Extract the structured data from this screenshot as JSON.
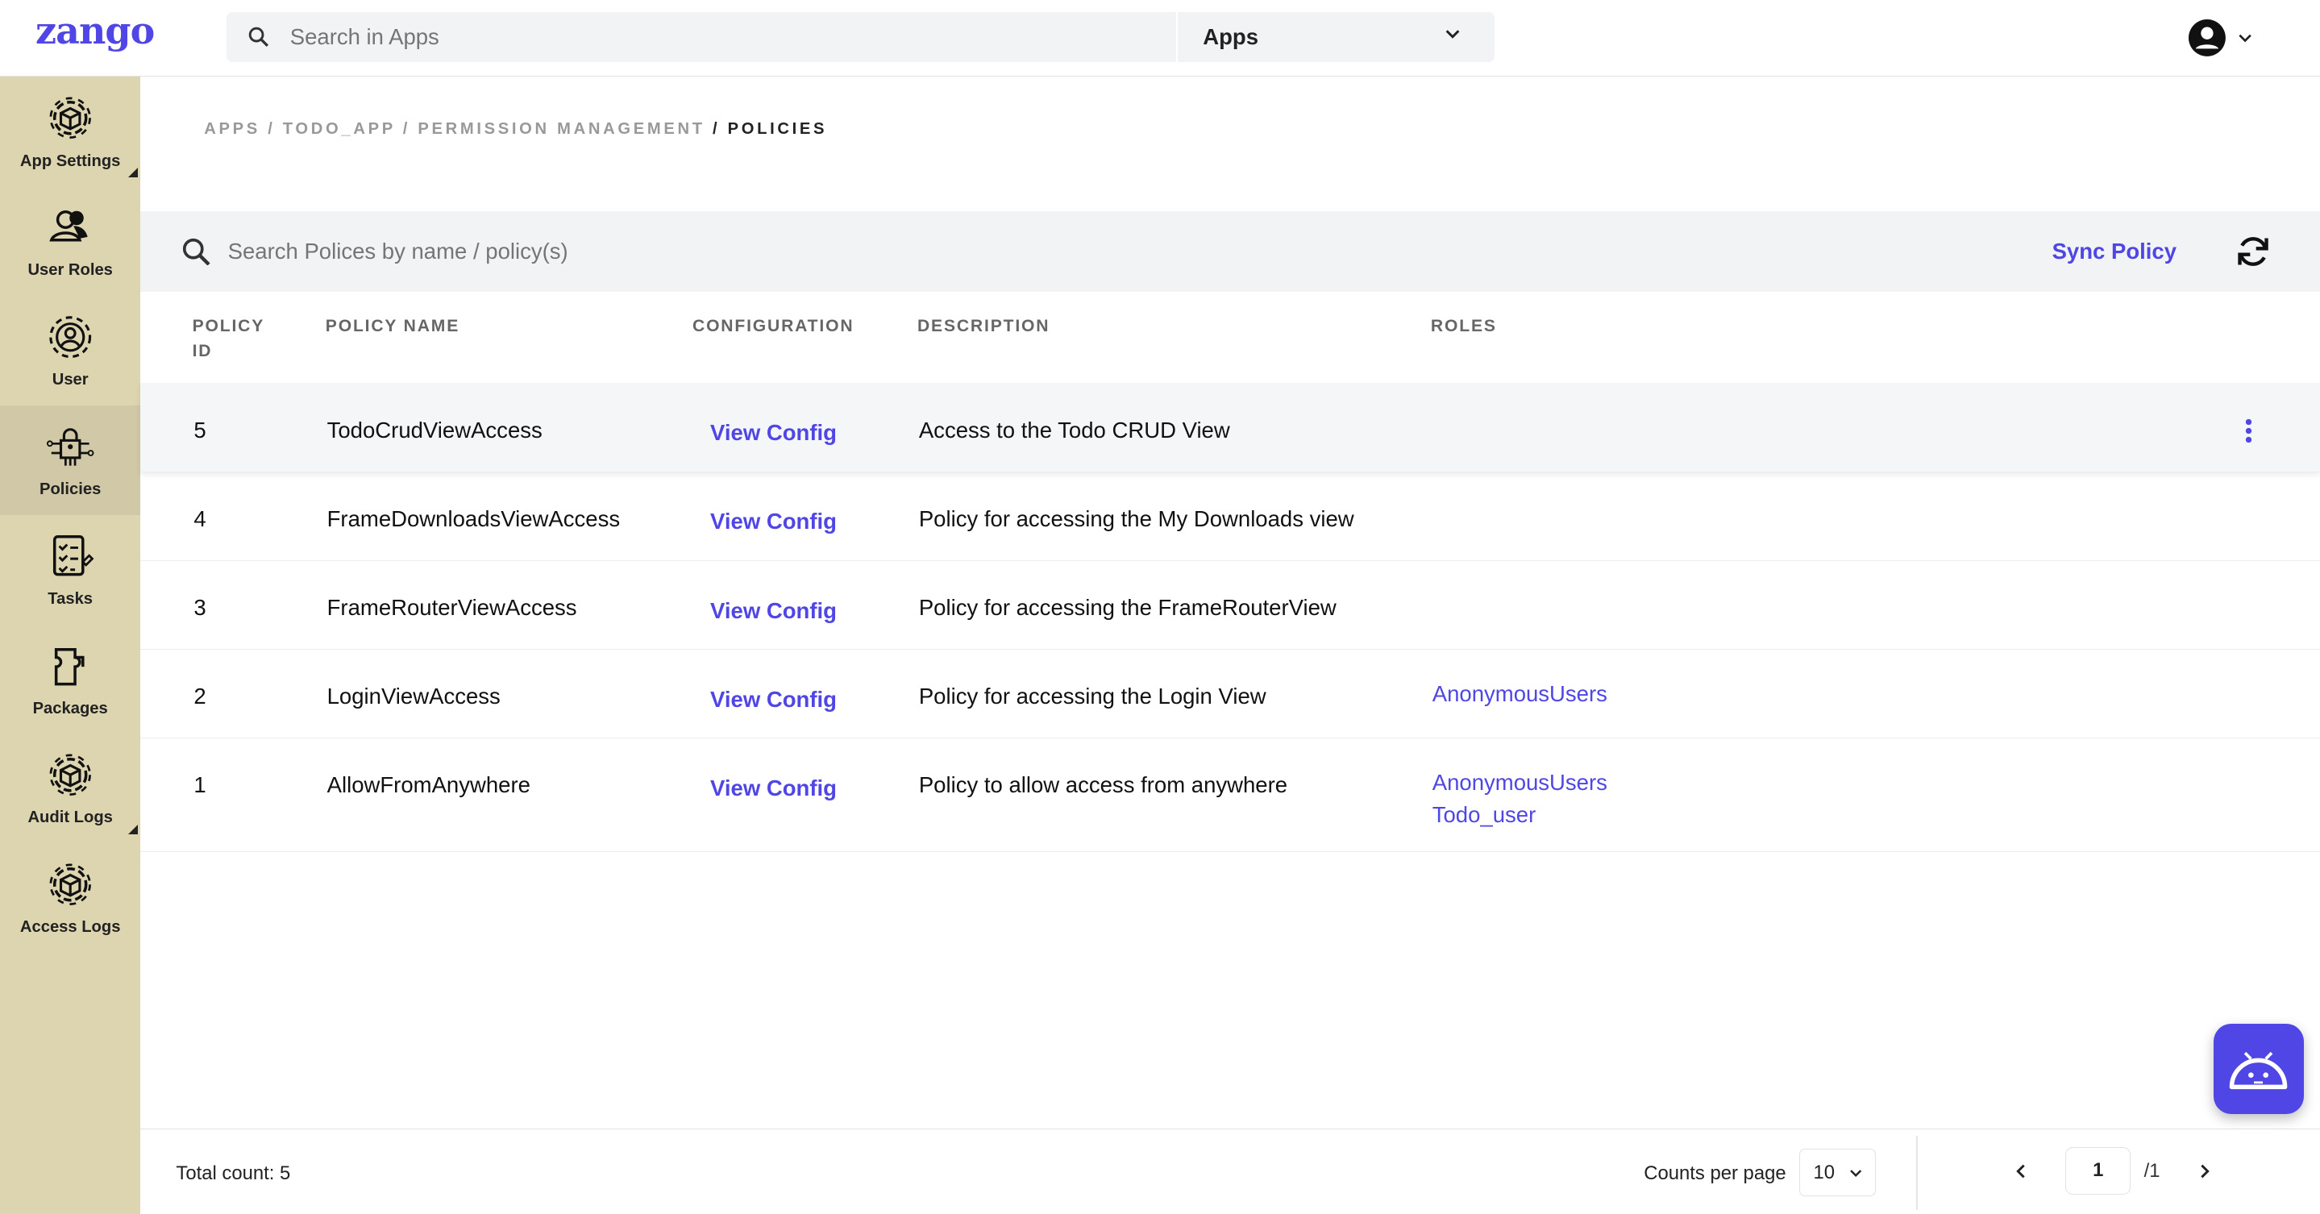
{
  "header": {
    "logo": "zango",
    "search_placeholder": "Search in Apps",
    "app_select": "Apps"
  },
  "sidebar": {
    "items": [
      {
        "label": "App Settings",
        "icon": "gear-cube-icon"
      },
      {
        "label": "User Roles",
        "icon": "users-icon"
      },
      {
        "label": "User",
        "icon": "gear-user-icon"
      },
      {
        "label": "Policies",
        "icon": "policy-lock-icon",
        "active": true
      },
      {
        "label": "Tasks",
        "icon": "checklist-icon"
      },
      {
        "label": "Packages",
        "icon": "package-icon"
      },
      {
        "label": "Audit Logs",
        "icon": "gear-cube-icon"
      },
      {
        "label": "Access Logs",
        "icon": "gear-cube-icon"
      }
    ]
  },
  "breadcrumb": {
    "items": [
      "APPS",
      "TODO_APP",
      "PERMISSION MANAGEMENT"
    ],
    "current": "POLICIES",
    "sep": "/"
  },
  "toolbar": {
    "search_placeholder": "Search Polices by name / policy(s)",
    "sync_label": "Sync Policy"
  },
  "table": {
    "columns": [
      "POLICY ID",
      "POLICY NAME",
      "CONFIGURATION",
      "DESCRIPTION",
      "ROLES"
    ],
    "rows": [
      {
        "id": "5",
        "name": "TodoCrudViewAccess",
        "config": "View Config",
        "description": "Access to the Todo CRUD View",
        "roles": []
      },
      {
        "id": "4",
        "name": "FrameDownloadsViewAccess",
        "config": "View Config",
        "description": "Policy for accessing the My Downloads view",
        "roles": []
      },
      {
        "id": "3",
        "name": "FrameRouterViewAccess",
        "config": "View Config",
        "description": "Policy for accessing the FrameRouterView",
        "roles": []
      },
      {
        "id": "2",
        "name": "LoginViewAccess",
        "config": "View Config",
        "description": "Policy for accessing the Login View",
        "roles": [
          "AnonymousUsers"
        ]
      },
      {
        "id": "1",
        "name": "AllowFromAnywhere",
        "config": "View Config",
        "description": "Policy to allow access from anywhere",
        "roles": [
          "AnonymousUsers",
          "Todo_user"
        ]
      }
    ]
  },
  "footer": {
    "total": "Total count: 5",
    "counts_label": "Counts per page",
    "per_page": "10",
    "page": "1",
    "pages": "/1"
  },
  "colors": {
    "accent": "#4f46e5",
    "sidebar": "#ddd5b0"
  }
}
